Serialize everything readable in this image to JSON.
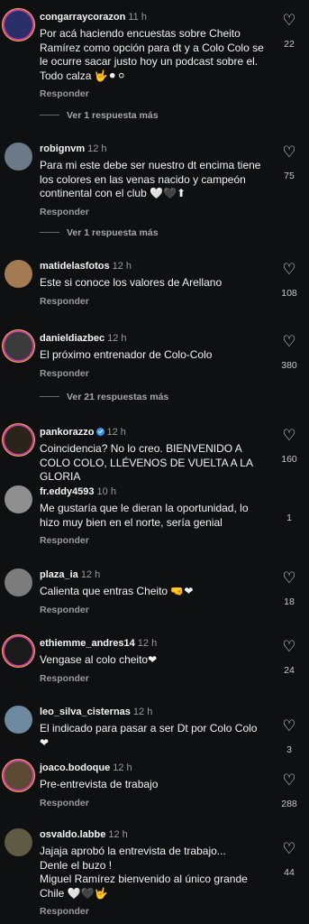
{
  "comments": [
    {
      "user": "congarraycorazon",
      "time": "11 h",
      "text": "Por acá haciendo encuestas sobre Cheito Ramírez como opción para dt y a Colo Colo se le ocurre sacar justo hoy un podcast sobre el. Todo calza 🤟⚫⚪",
      "reply": "Responder",
      "likes": "22",
      "avatar": "#2a2f6a"
    },
    {
      "user": "robignvm",
      "time": "12 h",
      "text": "Para mi este debe ser nuestro dt encima tiene los colores en las venas nacido y campeón continental con el club 🤍🖤⬆",
      "reply": "Responder",
      "likes": "75",
      "avatar": "#6b7a88"
    },
    {
      "user": "matidelasfotos",
      "time": "12 h",
      "text": "Este si conoce los valores de Arellano",
      "reply": "Responder",
      "likes": "108",
      "avatar": "#a37a52"
    },
    {
      "user": "danieldiazbec",
      "time": "12 h",
      "text": "El próximo entrenador de Colo-Colo",
      "reply": "Responder",
      "likes": "380",
      "avatar": "#3b3b3b"
    },
    {
      "user": "pankorazzo",
      "time": "12 h",
      "text": "Coincidencia? No lo creo. BIENVENIDO A COLO COLO, LLÉVENOS DE VUELTA A LA GLORIA",
      "reply": "Responder",
      "likes": "160",
      "avatar": "#2a2419"
    },
    {
      "user": "fr.eddy4593",
      "time": "10 h",
      "text": "Me gustaría que le dieran la oportunidad, lo hizo muy bien en el norte, sería genial",
      "reply": "Responder",
      "likes": "1",
      "avatar": "#8f8f8f"
    },
    {
      "user": "plaza_ia",
      "time": "12 h",
      "text": "Calienta que entras Cheito 🤜❤",
      "reply": "Responder",
      "likes": "18",
      "avatar": "#7c7c7c"
    },
    {
      "user": "ethiemme_andres14",
      "time": "12 h",
      "text": "Vengase al colo cheito❤",
      "reply": "Responder",
      "likes": "24",
      "avatar": "#1a1a1a"
    },
    {
      "user": "leo_silva_cisternas",
      "time": "12 h",
      "text": "El indicado para pasar a ser Dt por Colo Colo ❤",
      "reply": "Responder",
      "likes": "3",
      "avatar": "#6d8aa0"
    },
    {
      "user": "joaco.bodoque",
      "time": "12 h",
      "text": "Pre-entrevista de trabajo",
      "reply": "Responder",
      "likes": "288",
      "avatar": "#5c4a35"
    },
    {
      "user": "osvaldo.labbe",
      "time": "12 h",
      "text": "Jajaja aprobó la entrevista de trabajo...\nDenle el buzo !\nMiguel Ramírez bienvenido al único grande Chile 🤍🖤🤟",
      "reply": "Responder",
      "likes": "44",
      "avatar": "#5e5a44"
    }
  ],
  "more_replies": [
    {
      "label": "Ver 1 respuesta más"
    },
    {
      "label": "Ver 1 respuesta más"
    },
    {
      "label": "Ver 21 respuestas más"
    }
  ],
  "icons": {
    "like": "heart-icon",
    "verified": "verified-badge-icon"
  }
}
